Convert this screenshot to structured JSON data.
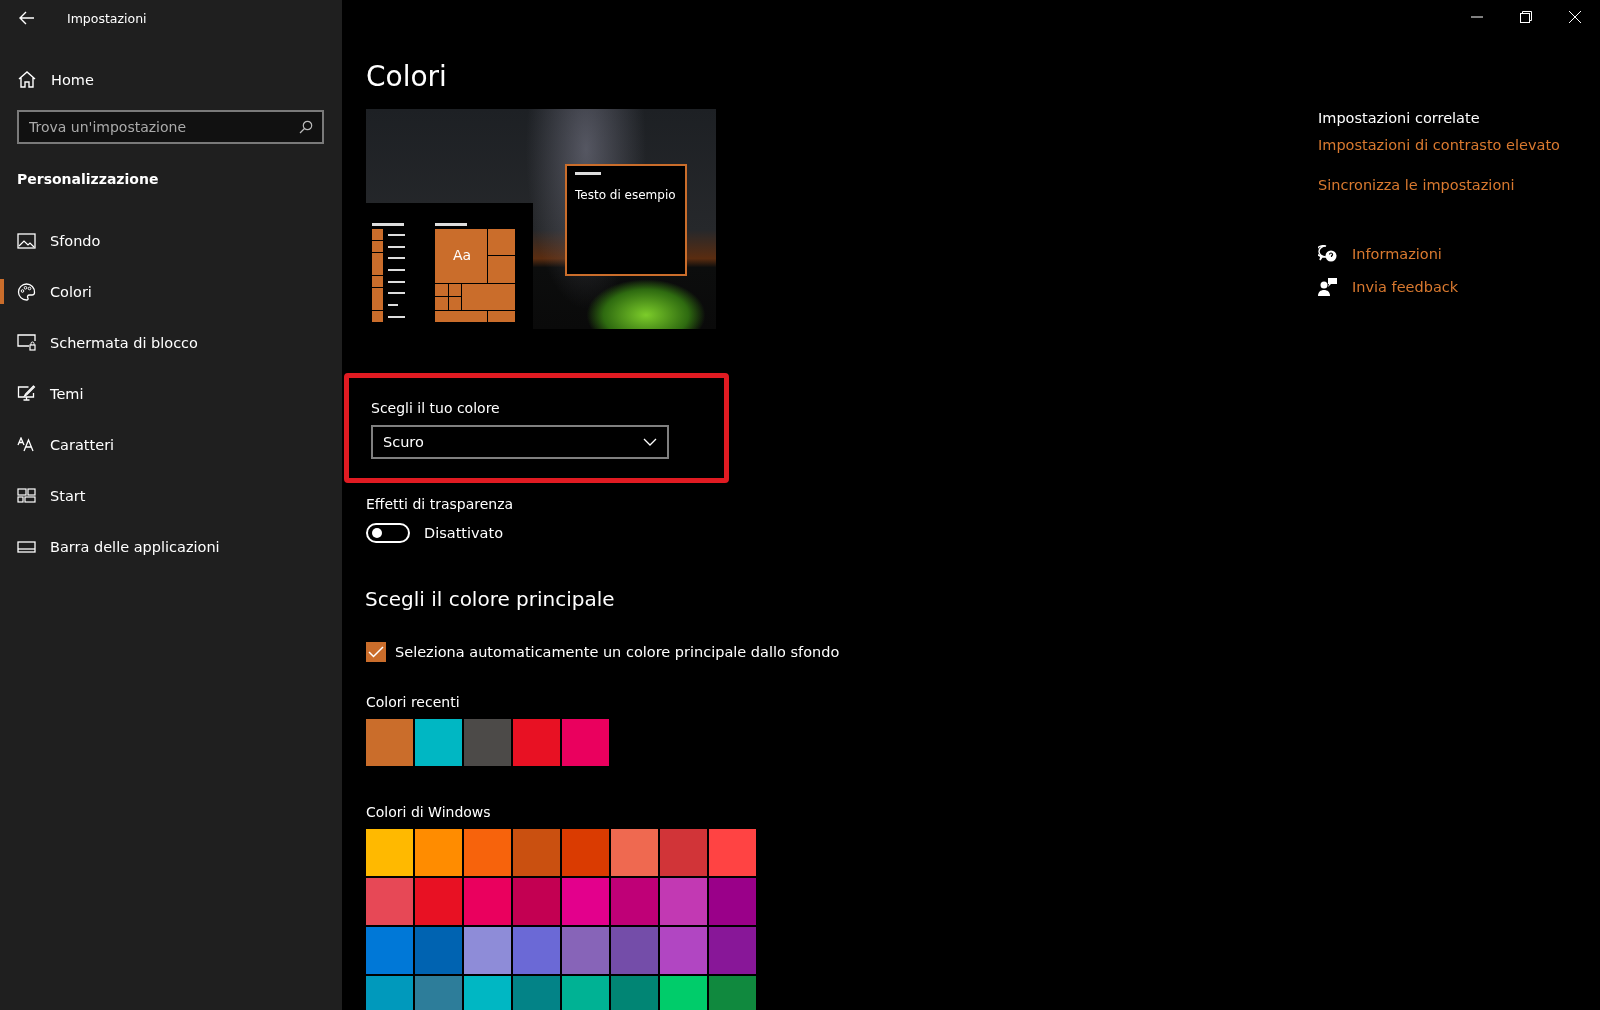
{
  "window": {
    "title": "Impostazioni"
  },
  "sidebar": {
    "home": "Home",
    "search": {
      "placeholder": "Trova un'impostazione"
    },
    "section": "Personalizzazione",
    "items": [
      {
        "label": "Sfondo",
        "selected": false
      },
      {
        "label": "Colori",
        "selected": true
      },
      {
        "label": "Schermata di blocco",
        "selected": false
      },
      {
        "label": "Temi",
        "selected": false
      },
      {
        "label": "Caratteri",
        "selected": false
      },
      {
        "label": "Start",
        "selected": false
      },
      {
        "label": "Barra delle applicazioni",
        "selected": false
      }
    ]
  },
  "page": {
    "title": "Colori",
    "preview": {
      "sample_text": "Testo di esempio",
      "tile_text": "Aa"
    },
    "mode": {
      "label": "Scegli il tuo colore",
      "value": "Scuro",
      "highlighted": true
    },
    "transparency": {
      "label": "Effetti di trasparenza",
      "on": false,
      "state_text": "Disattivato"
    },
    "accent_heading": "Scegli il colore principale",
    "auto_accent": {
      "label": "Seleziona automaticamente un colore principale dallo sfondo",
      "checked": true
    },
    "recent": {
      "label": "Colori recenti",
      "swatches": [
        {
          "color": "#ca6d2b"
        },
        {
          "color": "#00b7c3"
        },
        {
          "color": "#4c4a48"
        },
        {
          "color": "#e81123"
        },
        {
          "color": "#ea005e"
        }
      ]
    },
    "windows_colors": {
      "label": "Colori di Windows",
      "swatches": [
        {
          "color": "#ffb900"
        },
        {
          "color": "#ff8c00"
        },
        {
          "color": "#f7630c"
        },
        {
          "color": "#ca5010"
        },
        {
          "color": "#da3b01"
        },
        {
          "color": "#ef6950"
        },
        {
          "color": "#d13438"
        },
        {
          "color": "#ff4343"
        },
        {
          "color": "#e74856"
        },
        {
          "color": "#e81123"
        },
        {
          "color": "#ea005e"
        },
        {
          "color": "#c30052"
        },
        {
          "color": "#e3008c"
        },
        {
          "color": "#bf0077"
        },
        {
          "color": "#c239b3"
        },
        {
          "color": "#9a0089"
        },
        {
          "color": "#0078d7"
        },
        {
          "color": "#0063b1"
        },
        {
          "color": "#8e8cd8"
        },
        {
          "color": "#6b69d6"
        },
        {
          "color": "#8764b8"
        },
        {
          "color": "#744da9"
        },
        {
          "color": "#b146c2"
        },
        {
          "color": "#881798"
        },
        {
          "color": "#0099bc"
        },
        {
          "color": "#2d7d9a"
        },
        {
          "color": "#00b7c3"
        },
        {
          "color": "#038387"
        },
        {
          "color": "#00b294"
        },
        {
          "color": "#018574"
        },
        {
          "color": "#00cc6a"
        },
        {
          "color": "#10893e"
        }
      ]
    }
  },
  "related": {
    "title": "Impostazioni correlate",
    "links": [
      "Impostazioni di contrasto elevato",
      "Sincronizza le impostazioni"
    ],
    "help": [
      {
        "label": "Informazioni"
      },
      {
        "label": "Invia feedback"
      }
    ]
  }
}
